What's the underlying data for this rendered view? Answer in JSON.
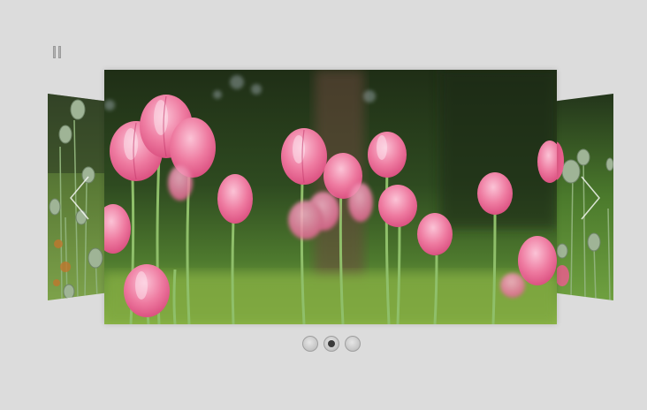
{
  "slider": {
    "pause_icon": "pause-icon",
    "prev_icon": "chevron-left-icon",
    "next_icon": "chevron-right-icon",
    "slides": [
      {
        "name": "poppy-seedheads",
        "position": "left"
      },
      {
        "name": "pink-tulips",
        "position": "center",
        "active": true
      },
      {
        "name": "poppy-seedheads-pink",
        "position": "right"
      }
    ],
    "pagination": {
      "total": 3,
      "active_index": 1
    }
  },
  "colors": {
    "background": "#dcdcdc",
    "tulip_pink": "#ec6a93",
    "foliage_green": "#2f5a24",
    "dot_active": "#3a3a3a"
  }
}
